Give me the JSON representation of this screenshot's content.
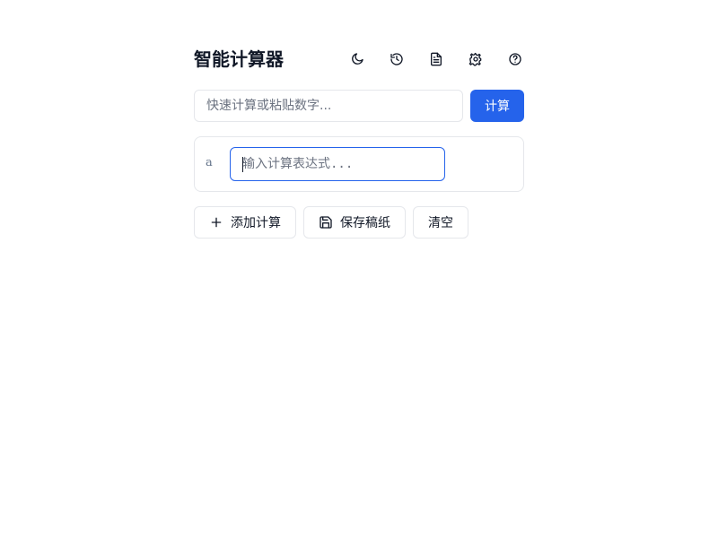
{
  "header": {
    "title": "智能计算器"
  },
  "toolbar": {
    "icons": [
      "moon-icon",
      "history-icon",
      "document-icon",
      "gear-icon",
      "help-icon"
    ]
  },
  "quick_calc": {
    "placeholder": "快速计算或粘贴数字...",
    "value": "",
    "button_label": "计算"
  },
  "calculation_lines": [
    {
      "variable": "a",
      "expression": "",
      "placeholder": "输入计算表达式..."
    }
  ],
  "actions": {
    "add_label": "添加计算",
    "save_label": "保存稿纸",
    "clear_label": "清空"
  },
  "colors": {
    "primary": "#2563eb",
    "border": "#e5e7eb",
    "text": "#111827",
    "muted": "#6b7280",
    "background": "#ffffff"
  }
}
